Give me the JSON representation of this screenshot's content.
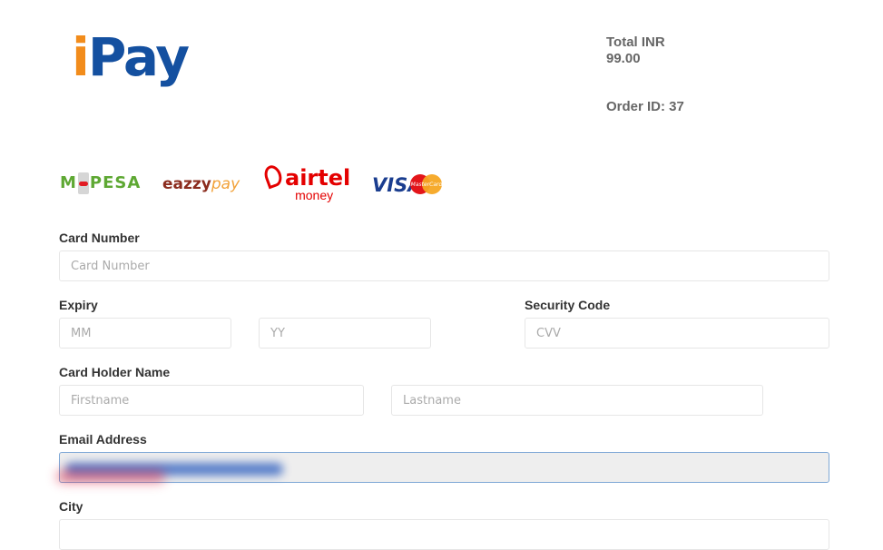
{
  "brand": {
    "logo_i": "i",
    "logo_pay": "Pay"
  },
  "summary": {
    "total_label": "Total INR",
    "total_amount": "99.00",
    "order_label": "Order ID: 37"
  },
  "providers": {
    "mpesa_m": "M",
    "mpesa_rest": "PESA",
    "eazzy_a": "eazzy",
    "eazzy_b": "pay",
    "airtel_a": "airtel",
    "airtel_b": "money",
    "visa": "VISA",
    "mastercard": "MasterCard"
  },
  "form": {
    "card_number": {
      "label": "Card Number",
      "placeholder": "Card Number",
      "value": ""
    },
    "expiry": {
      "label": "Expiry",
      "month_placeholder": "MM",
      "year_placeholder": "YY"
    },
    "security": {
      "label": "Security Code",
      "placeholder": "CVV"
    },
    "holder": {
      "label": "Card Holder Name",
      "first_placeholder": "Firstname",
      "last_placeholder": "Lastname"
    },
    "email": {
      "label": "Email Address",
      "value": ""
    },
    "city": {
      "label": "City"
    }
  },
  "colors": {
    "logo_i": "#f28c1b",
    "logo_pay": "#1450a0",
    "focus_border": "#7fa8d6"
  }
}
